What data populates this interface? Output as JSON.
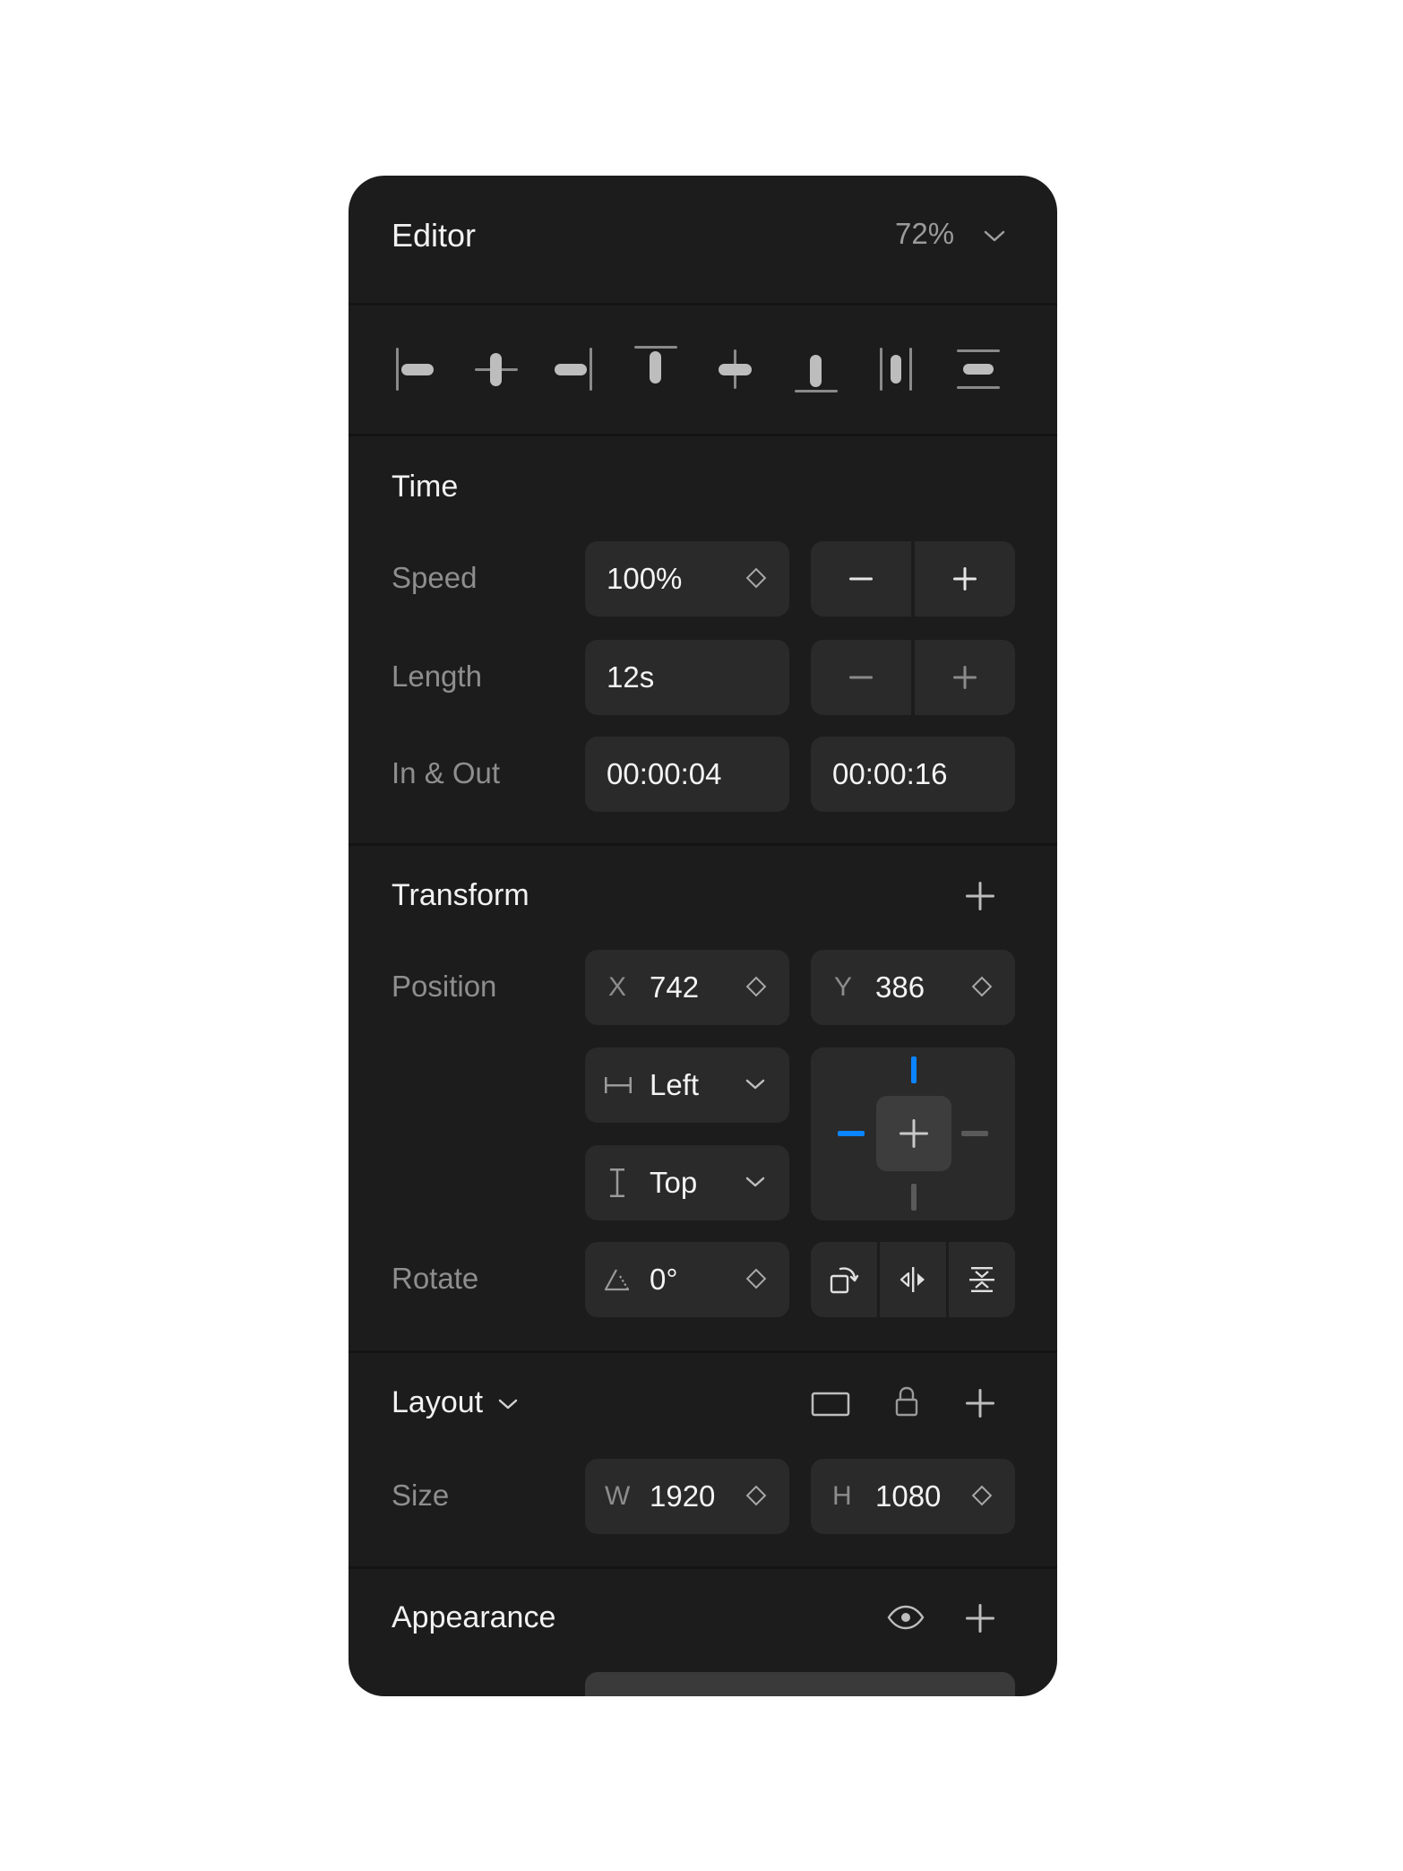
{
  "header": {
    "title": "Editor",
    "zoom": "72%"
  },
  "toolbar": {
    "icons": [
      "align-left-icon",
      "align-center-horizontal-icon",
      "align-right-icon",
      "align-top-icon",
      "align-center-vertical-icon",
      "align-bottom-icon",
      "distribute-horizontal-icon",
      "distribute-vertical-icon"
    ]
  },
  "time": {
    "title": "Time",
    "speed": {
      "label": "Speed",
      "value": "100%"
    },
    "length": {
      "label": "Length",
      "value": "12s"
    },
    "in_out": {
      "label": "In & Out",
      "in": "00:00:04",
      "out": "00:00:16"
    }
  },
  "transform": {
    "title": "Transform",
    "position": {
      "label": "Position",
      "x_prefix": "X",
      "x": "742",
      "y_prefix": "Y",
      "y": "386"
    },
    "h_align": "Left",
    "v_align": "Top",
    "rotate": {
      "label": "Rotate",
      "value": "0°"
    }
  },
  "layout": {
    "title": "Layout",
    "size": {
      "label": "Size",
      "w_prefix": "W",
      "w": "1920",
      "h_prefix": "H",
      "h": "1080"
    }
  },
  "appearance": {
    "title": "Appearance"
  },
  "colors": {
    "panel": "#1c1c1c",
    "field": "#2a2a2a",
    "accent": "#0a84ff",
    "label": "#8e8e8e"
  }
}
